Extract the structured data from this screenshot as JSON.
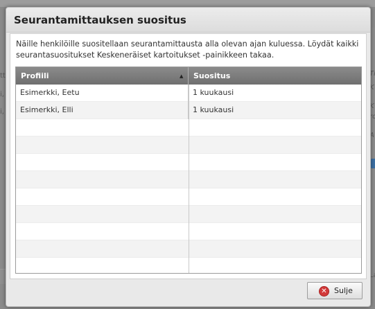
{
  "dialog": {
    "title": "Seurantamittauksen suositus",
    "intro": "Näille henkilöille suositellaan seurantamittausta alla olevan ajan kuluessa. Löydät kaikki seurantasuositukset Keskeneräiset kartoitukset -painikkeen takaa.",
    "grid": {
      "columns": [
        "Profiili",
        "Suositus"
      ],
      "sort_indicator": "▲",
      "rows": [
        {
          "profile": "Esimerkki, Eetu",
          "recommendation": "1 kuukausi"
        },
        {
          "profile": "Esimerkki, Elli",
          "recommendation": "1 kuukausi"
        }
      ]
    },
    "close_label": "Sulje",
    "close_icon": "close-icon"
  },
  "background": {
    "right_snippets": [
      "Ti",
      "K",
      "K",
      "ro",
      "A"
    ],
    "left_snippets": [
      "i,",
      "i,",
      "tt",
      "La"
    ]
  }
}
